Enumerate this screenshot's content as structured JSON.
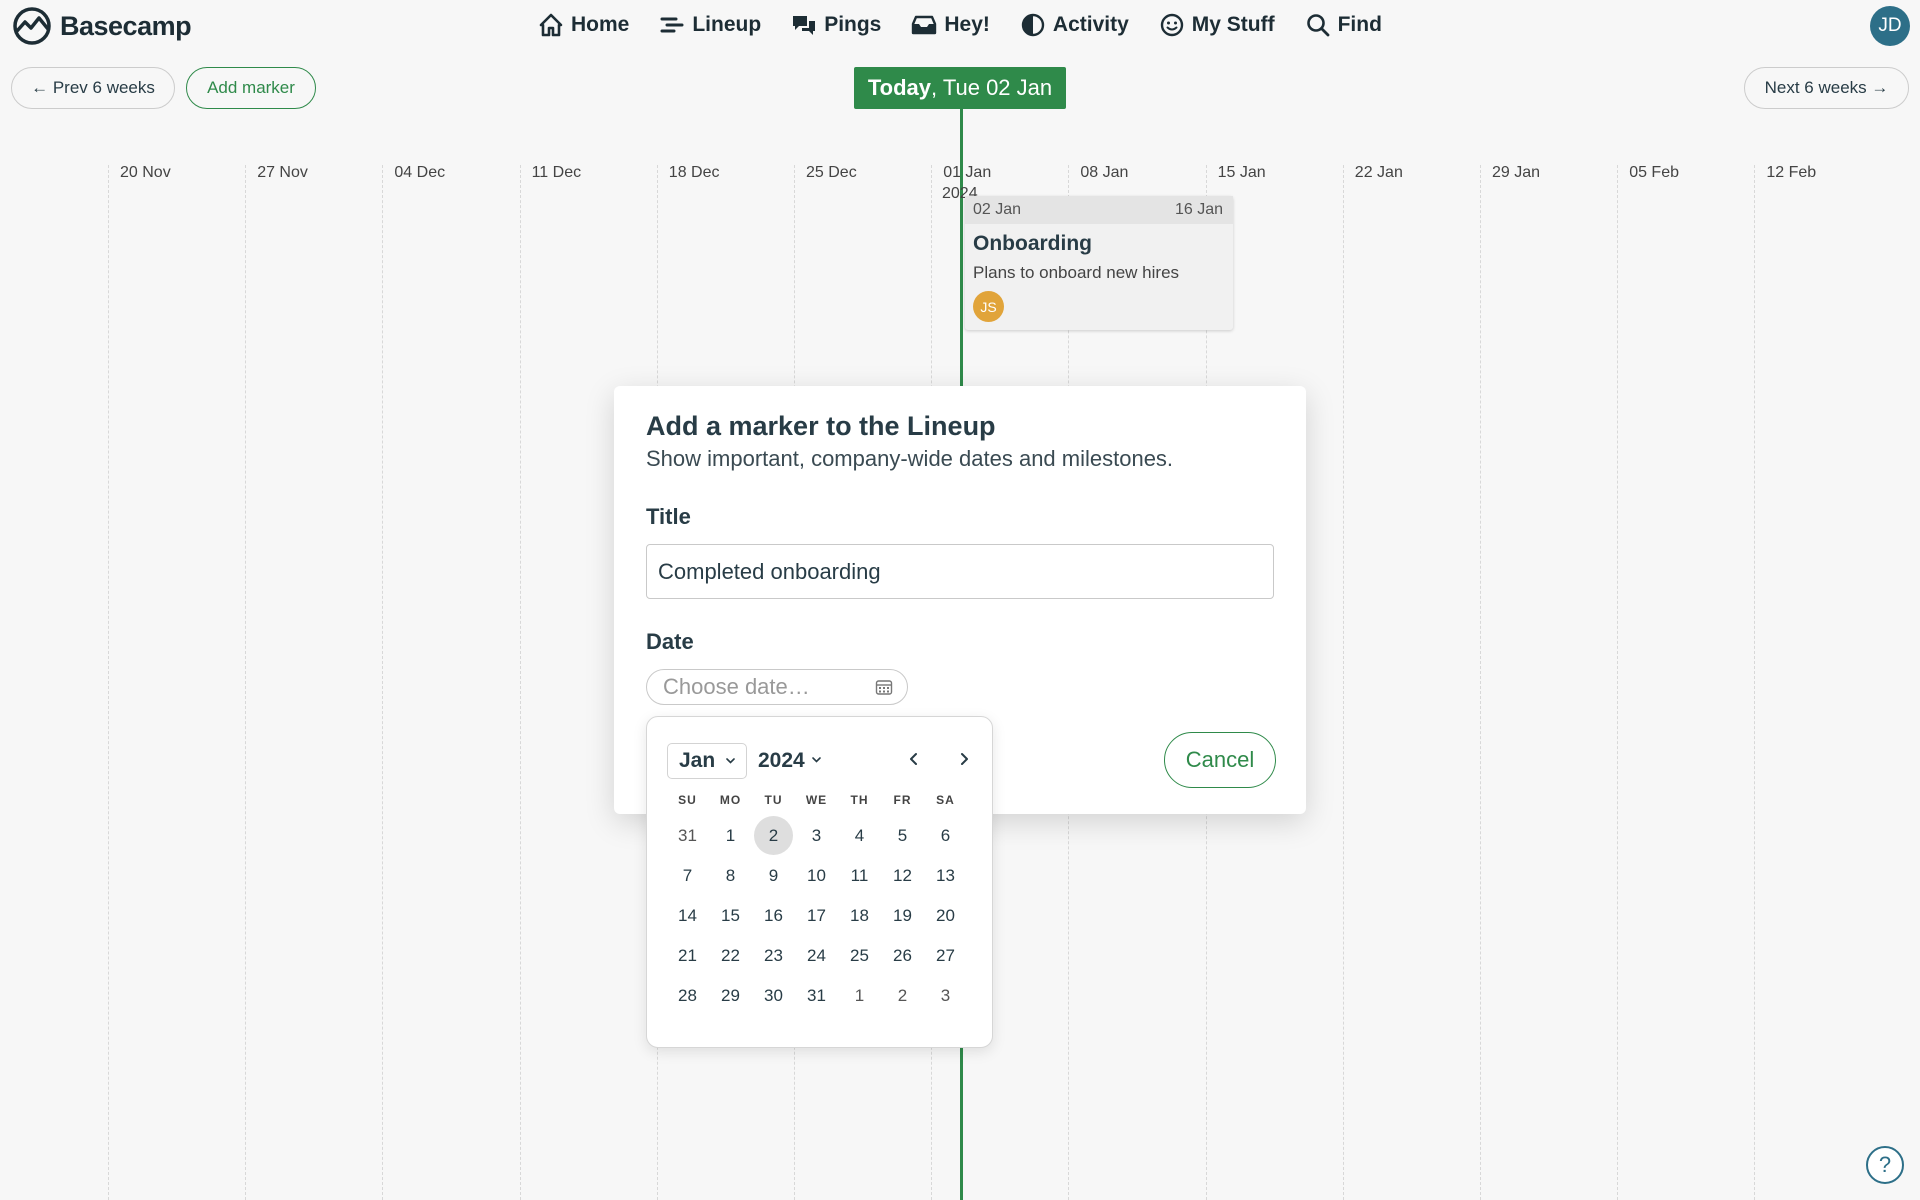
{
  "app": {
    "logo_text": "Basecamp"
  },
  "nav": {
    "home": "Home",
    "lineup": "Lineup",
    "pings": "Pings",
    "hey": "Hey!",
    "activity": "Activity",
    "my_stuff": "My Stuff",
    "find": "Find"
  },
  "user": {
    "initials": "JD"
  },
  "toolbar": {
    "prev": "← Prev 6 weeks",
    "add_marker": "Add marker",
    "next": "Next 6 weeks →",
    "today_bold": "Today",
    "today_rest": ", Tue 02 Jan"
  },
  "timeline": {
    "weeks": [
      "20 Nov",
      "27 Nov",
      "04 Dec",
      "11 Dec",
      "18 Dec",
      "25 Dec",
      "01 Jan",
      "08 Jan",
      "15 Jan",
      "22 Jan",
      "29 Jan",
      "05 Feb",
      "12 Feb"
    ],
    "year": "2024"
  },
  "project": {
    "start": "02 Jan",
    "end": "16 Jan",
    "title": "Onboarding",
    "description": "Plans to onboard new hires",
    "assignee_initials": "JS"
  },
  "modal": {
    "heading": "Add a marker to the Lineup",
    "subheading": "Show important, company-wide dates and milestones.",
    "title_label": "Title",
    "title_value": "Completed onboarding",
    "date_label": "Date",
    "date_placeholder": "Choose date…",
    "cancel": "Cancel"
  },
  "datepicker": {
    "month": "Jan",
    "year": "2024",
    "weekdays": [
      "SU",
      "MO",
      "TU",
      "WE",
      "TH",
      "FR",
      "SA"
    ],
    "weeks": [
      [
        "31",
        "1",
        "2",
        "3",
        "4",
        "5",
        "6"
      ],
      [
        "7",
        "8",
        "9",
        "10",
        "11",
        "12",
        "13"
      ],
      [
        "14",
        "15",
        "16",
        "17",
        "18",
        "19",
        "20"
      ],
      [
        "21",
        "22",
        "23",
        "24",
        "25",
        "26",
        "27"
      ],
      [
        "28",
        "29",
        "30",
        "31",
        "1",
        "2",
        "3"
      ]
    ],
    "selected_day": "2"
  },
  "help": {
    "label": "?"
  },
  "colors": {
    "accent": "#2f8a4a",
    "avatar_jd": "#2d6f88",
    "avatar_js": "#e1a43a"
  }
}
